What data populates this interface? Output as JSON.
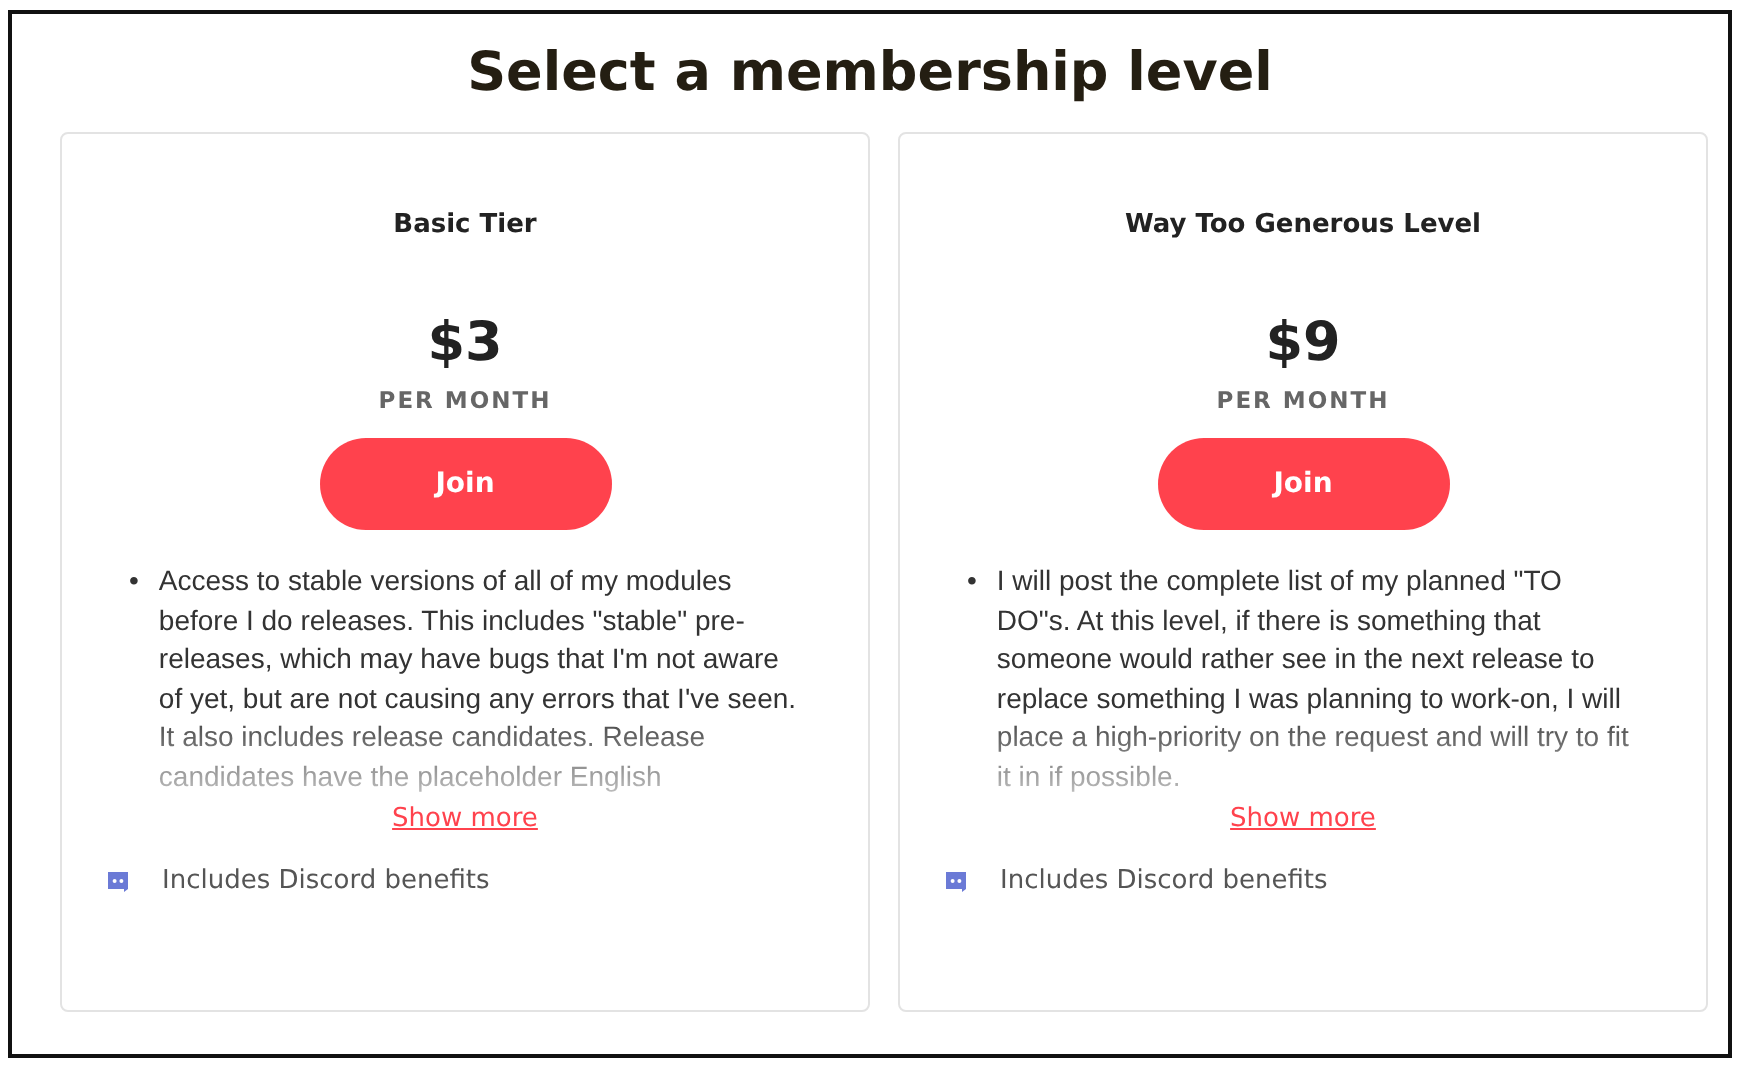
{
  "title": "Select a membership level",
  "tiers": [
    {
      "name": "Basic Tier",
      "price": "$3",
      "period": "PER MONTH",
      "button": "Join",
      "bullet": "•",
      "benefits": [
        "Access to stable versions of all of my modules before I do releases.  This includes \"stable\" pre-releases, which may have bugs that I'm not aware of yet, but are not causing any errors that I've seen.  It also includes release candidates.  Release candidates have the placeholder English"
      ],
      "show_more": "Show more",
      "perk": "Includes Discord benefits"
    },
    {
      "name": "Way Too Generous Level",
      "price": "$9",
      "period": "PER MONTH",
      "button": "Join",
      "bullet": "•",
      "benefits": [
        "I will post the complete list of my planned \"TO DO\"s.  At this level, if there is something that someone would rather see in the next release to replace something I was planning to work-on, I will place a high-priority on the request and will try to fit it in if possible."
      ],
      "show_more": "Show more",
      "perk": "Includes Discord benefits"
    }
  ]
}
